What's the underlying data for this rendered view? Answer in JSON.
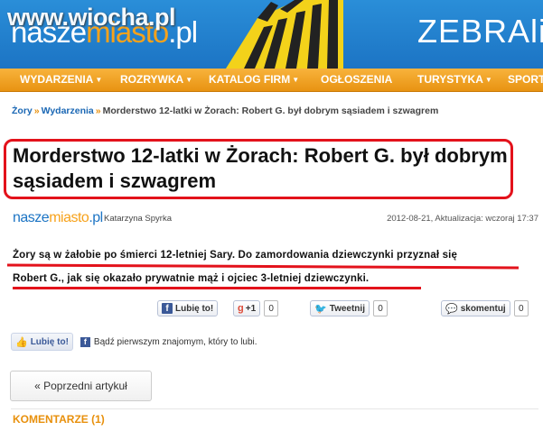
{
  "watermark": "www.wiocha.pl",
  "header": {
    "logo_part1": "nasze",
    "logo_part2": "miasto",
    "logo_part3": ".pl",
    "ad_text": "ZEBRAli",
    "colors": {
      "blue": "#1c74c4",
      "orange": "#f7a21b",
      "red_markup": "#e3121b"
    }
  },
  "nav": {
    "items": [
      {
        "label": "WYDARZENIA",
        "has_arrow": true
      },
      {
        "label": "ROZRYWKA",
        "has_arrow": true
      },
      {
        "label": "KATALOG FIRM",
        "has_arrow": true
      },
      {
        "label": "OGŁOSZENIA",
        "has_arrow": false
      },
      {
        "label": "TURYSTYKA",
        "has_arrow": true
      },
      {
        "label": "SPORT",
        "has_arrow": false
      }
    ]
  },
  "breadcrumb": {
    "items": [
      "Żory",
      "Wydarzenia"
    ],
    "current": "Morderstwo 12-latki w Żorach: Robert G. był dobrym sąsiadem i szwagrem"
  },
  "article": {
    "title": "Morderstwo 12-latki w Żorach: Robert G. był dobrym sąsiadem i szwagrem",
    "author": "Katarzyna Spyrka",
    "date": "2012-08-21, Aktualizacja: wczoraj 17:37",
    "lead_line1": "Żory są w żałobie po śmierci 12-letniej Sary. Do zamordowania dziewczynki przyznał się",
    "lead_line2": "Robert G., jak się okazało prywatnie mąż i ojciec 3-letniej dziewczynki."
  },
  "share": {
    "fb_label": "Lubię to!",
    "gplus_label": "+1",
    "gplus_count": "0",
    "tweet_label": "Tweetnij",
    "tweet_count": "0",
    "comment_label": "skomentuj",
    "comment_count": "0"
  },
  "fblike": {
    "button_label": "Lubię to!",
    "text": "Bądź pierwszym znajomym, który to lubi."
  },
  "prev_label": "« Poprzedni artykuł",
  "comments_heading": "KOMENTARZE (1)"
}
